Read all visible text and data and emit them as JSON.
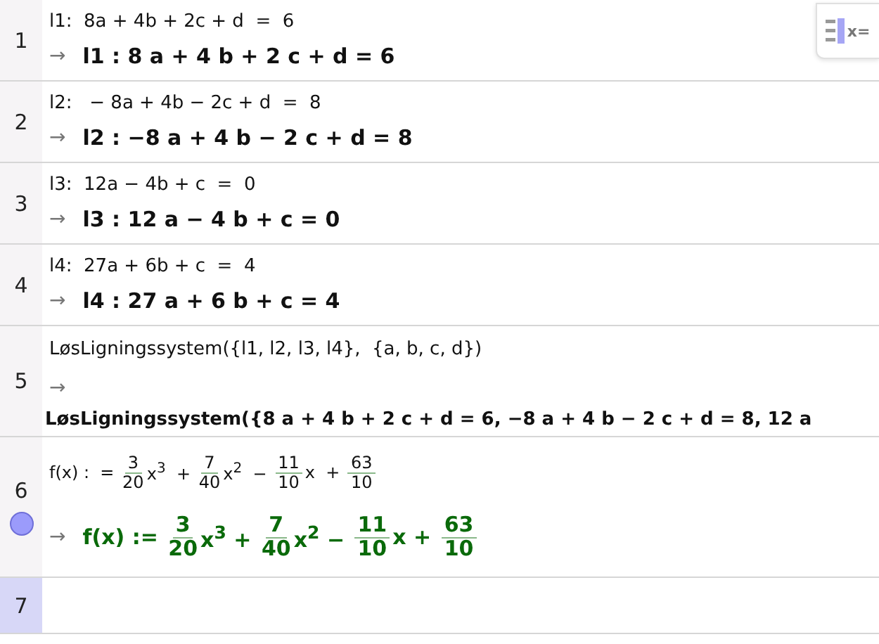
{
  "keyboard_button": {
    "label": "x="
  },
  "rows": [
    {
      "number": "1",
      "kind": "equation",
      "selected": false,
      "input": [
        {
          "kind": "text",
          "text": "l1:  8a + 4b + 2c + d  =  6"
        }
      ],
      "arrow": "→",
      "output": [
        {
          "kind": "text",
          "text": "l1 : 8 a + 4 b + 2 c + d = 6"
        }
      ]
    },
    {
      "number": "2",
      "kind": "equation",
      "selected": false,
      "input": [
        {
          "kind": "text",
          "text": "l2:   − 8a + 4b − 2c + d  =  8"
        }
      ],
      "arrow": "→",
      "output": [
        {
          "kind": "text",
          "text": "l2 : −8 a + 4 b − 2 c + d = 8"
        }
      ]
    },
    {
      "number": "3",
      "kind": "equation",
      "selected": false,
      "input": [
        {
          "kind": "text",
          "text": "l3:  12a − 4b + c  =  0"
        }
      ],
      "arrow": "→",
      "output": [
        {
          "kind": "text",
          "text": "l3 : 12 a − 4 b + c = 0"
        }
      ]
    },
    {
      "number": "4",
      "kind": "equation",
      "selected": false,
      "input": [
        {
          "kind": "text",
          "text": "l4:  27a + 6b + c  =  4"
        }
      ],
      "arrow": "→",
      "output": [
        {
          "kind": "text",
          "text": "l4 : 27 a + 6 b + c = 4"
        }
      ]
    },
    {
      "number": "5",
      "kind": "command",
      "selected": false,
      "input": [
        {
          "kind": "text",
          "text": "LøsLigningssystem({l1, l2, l3, l4},  {a, b, c, d})"
        }
      ],
      "arrow": "→",
      "output": [
        {
          "kind": "text",
          "text": "LøsLigningssystem({8 a + 4 b + 2 c + d = 6, −8 a + 4 b − 2 c + d = 8, 12 a"
        }
      ]
    },
    {
      "number": "6",
      "kind": "function",
      "selected": false,
      "visible": true,
      "input": [
        {
          "kind": "text",
          "text": "f(x) :  = "
        },
        {
          "kind": "frac",
          "num": "3",
          "den": "20"
        },
        {
          "kind": "text",
          "text": "x$^{3}$  + "
        },
        {
          "kind": "frac",
          "num": "7",
          "den": "40"
        },
        {
          "kind": "text",
          "text": "x$^{2}$  − "
        },
        {
          "kind": "frac",
          "num": "11",
          "den": "10"
        },
        {
          "kind": "text",
          "text": "x  + "
        },
        {
          "kind": "frac",
          "num": "63",
          "den": "10"
        }
      ],
      "arrow": "→",
      "output": [
        {
          "kind": "text",
          "text": "f(x) := "
        },
        {
          "kind": "frac",
          "num": "3",
          "den": "20"
        },
        {
          "kind": "text",
          "text": "x$^{3}$ + "
        },
        {
          "kind": "frac",
          "num": "7",
          "den": "40"
        },
        {
          "kind": "text",
          "text": "x$^{2}$ − "
        },
        {
          "kind": "frac",
          "num": "11",
          "den": "10"
        },
        {
          "kind": "text",
          "text": "x + "
        },
        {
          "kind": "frac",
          "num": "63",
          "den": "10"
        }
      ]
    },
    {
      "number": "7",
      "kind": "empty",
      "selected": true
    }
  ]
}
